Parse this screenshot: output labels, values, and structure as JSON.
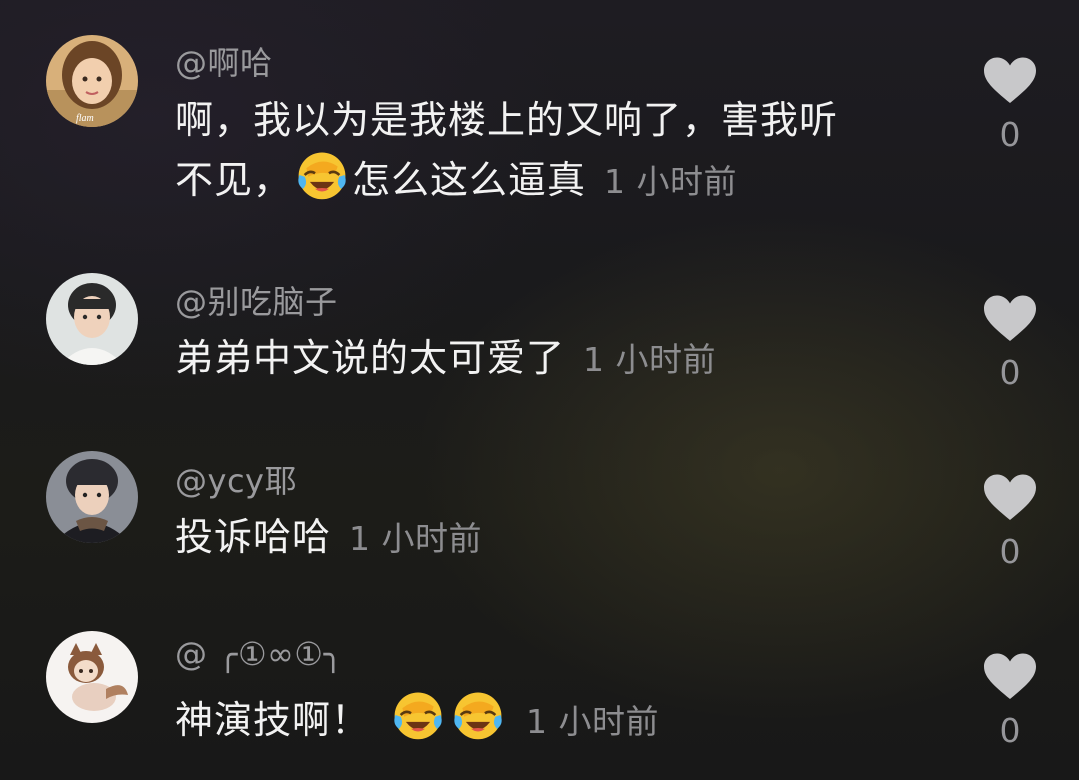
{
  "comments": [
    {
      "username": "@啊哈",
      "text_line1": "啊，我以为是我楼上的又响了，害我听",
      "text_line2_before": "不见，",
      "text_line2_after": "怎么这么逼真",
      "time": "1 小时前",
      "likes": "0",
      "emoji": "laughing-crying-emoji"
    },
    {
      "username": "@别吃脑子",
      "text": "弟弟中文说的太可爱了",
      "time": "1 小时前",
      "likes": "0"
    },
    {
      "username": "@ycy耶",
      "text": "投诉哈哈",
      "time": "1 小时前",
      "likes": "0"
    },
    {
      "username": "@ ╭①∞①╮",
      "text": "神演技啊！",
      "time": "1 小时前",
      "likes": "0",
      "emoji": "laughing-crying-emoji"
    }
  ],
  "colors": {
    "username": "#9a9a9d",
    "text": "#f2f2f2",
    "time": "#8d8d90",
    "heart": "#c8c8ca"
  }
}
